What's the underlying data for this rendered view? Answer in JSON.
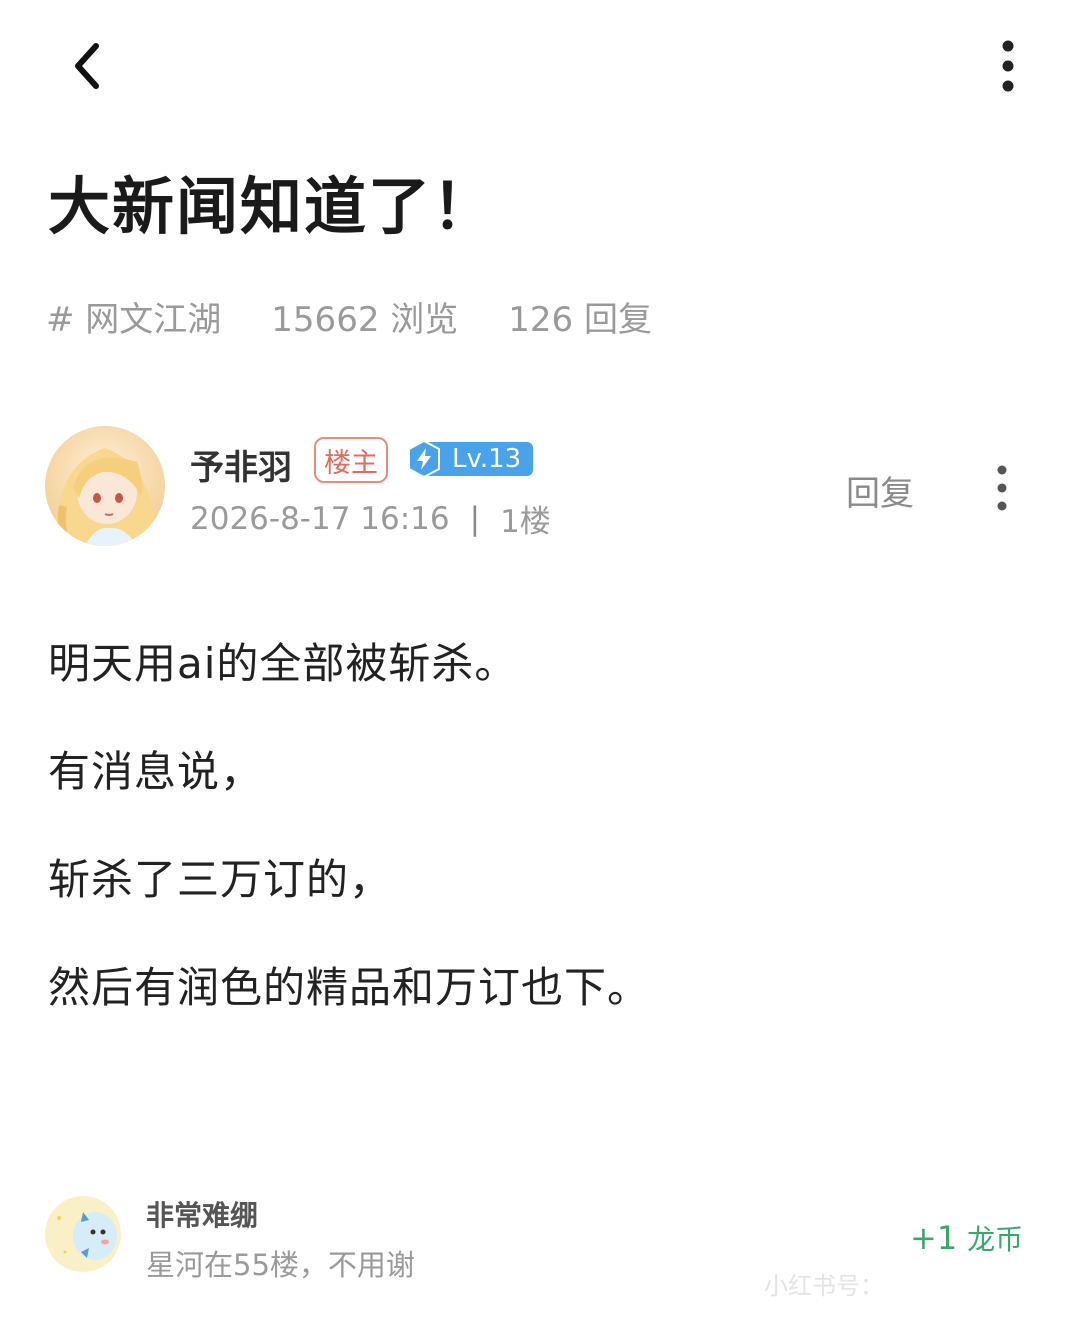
{
  "header": {
    "back_icon": "chevron-left-icon",
    "more_icon": "vertical-dots-icon"
  },
  "post": {
    "title": "大新闻知道了！",
    "meta": {
      "tag": "# 网文江湖",
      "views": "15662 浏览",
      "replies": "126 回复"
    },
    "author": {
      "name": "予非羽",
      "owner_badge": "楼主",
      "level": "Lv.13",
      "datetime": "2026-8-17 16:16",
      "divider": "|",
      "floor": "1楼",
      "reply_label": "回复"
    },
    "body": [
      "明天用ai的全部被斩杀。",
      "有消息说，",
      "斩杀了三万订的，",
      "然后有润色的精品和万订也下。"
    ]
  },
  "reply_preview": {
    "name": "非常难绷",
    "text": "星河在55楼，不用谢",
    "reward_amount": "+1",
    "reward_unit": "龙币"
  },
  "watermark": "小红书号：",
  "colors": {
    "accent_green": "#3aa86b",
    "badge_red": "#e06c5c",
    "level_blue": "#4aa3e8",
    "meta_gray": "#9a9a9a"
  }
}
